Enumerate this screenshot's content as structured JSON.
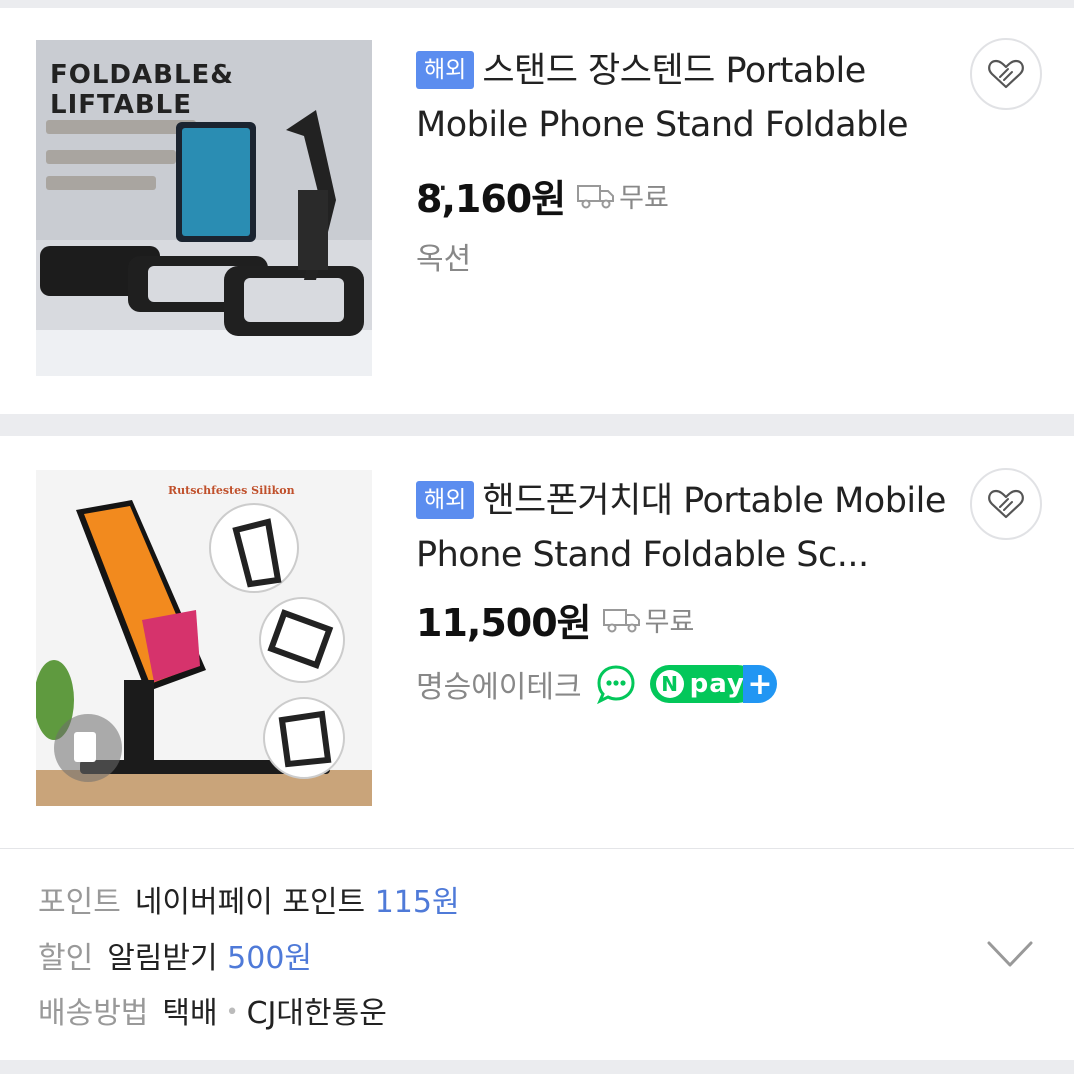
{
  "products": [
    {
      "badge": "해외",
      "title": "스탠드 장스텐드 Portable Mobile Phone Stand Foldable ...",
      "price": "8,160원",
      "shipping": "무료",
      "seller": "옥션",
      "image_text": {
        "headline1": "FOLDABLE&",
        "headline2": "LIFTABLE"
      }
    },
    {
      "badge": "해외",
      "title": "핸드폰거치대 Portable Mobile Phone Stand Foldable Sc...",
      "price": "11,500원",
      "shipping": "무료",
      "seller": "명승에이테크",
      "npay_label": "pay",
      "image_text": {
        "caption": "Rutschfestes Silikon"
      }
    }
  ],
  "info": {
    "point_label": "포인트",
    "point_text": "네이버페이 포인트",
    "point_value": "115원",
    "discount_label": "할인",
    "discount_text": "알림받기",
    "discount_value": "500원",
    "delivery_label": "배송방법",
    "delivery_method": "택배",
    "delivery_carrier": "CJ대한통운"
  },
  "colors": {
    "badge": "#5b8def",
    "npay": "#03c75a",
    "link_blue": "#4f7ad8"
  }
}
